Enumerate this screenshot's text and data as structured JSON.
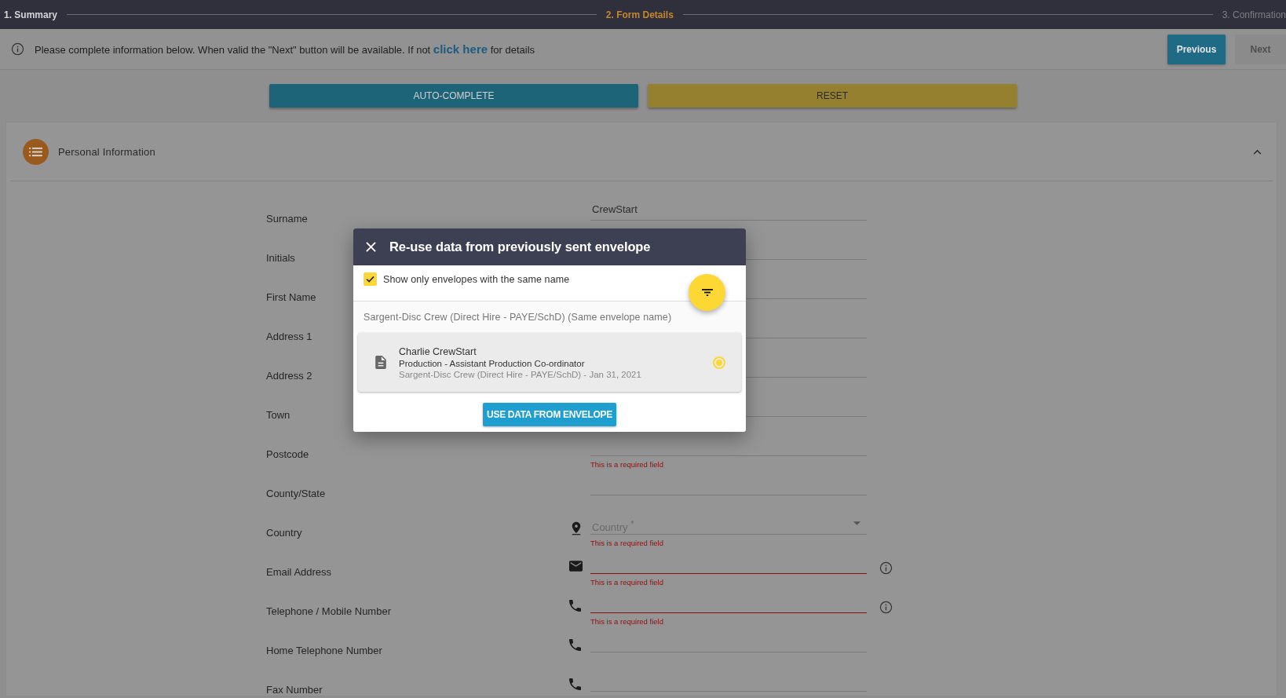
{
  "steps": [
    {
      "label": "1. Summary",
      "completed": true,
      "selected": false
    },
    {
      "label": "2. Form Details",
      "completed": false,
      "selected": true
    },
    {
      "label": "3. Confirmation",
      "completed": false,
      "selected": false
    }
  ],
  "info_bar": {
    "text_before": "Please complete information below. When valid the \"Next\" button will be available. If not ",
    "link": "click here",
    "text_after": " for details"
  },
  "nav_buttons": [
    {
      "label": "Previous",
      "disabled": false
    },
    {
      "label": "Next",
      "disabled": true
    }
  ],
  "actions": [
    {
      "label": "AUTO-COMPLETE",
      "kind": "primary"
    },
    {
      "label": "RESET",
      "kind": "warning"
    }
  ],
  "section": {
    "title": "Personal Information",
    "expanded": true
  },
  "fields": [
    {
      "label": "Surname",
      "kind": "text",
      "value": "CrewStart",
      "invalid": false
    },
    {
      "label": "Initials",
      "kind": "text",
      "invalid": false
    },
    {
      "label": "First Name",
      "kind": "text",
      "invalid": false
    },
    {
      "label": "Address 1",
      "kind": "text",
      "invalid": false
    },
    {
      "label": "Address 2",
      "kind": "text",
      "invalid": false
    },
    {
      "label": "Town",
      "kind": "text",
      "invalid": false
    },
    {
      "label": "Postcode",
      "kind": "text",
      "invalid": false,
      "error": "This is a required field"
    },
    {
      "label": "County/State",
      "kind": "text",
      "invalid": false
    },
    {
      "label": "Country",
      "kind": "select",
      "placeholder": "Country $^{*}$",
      "invalid": false,
      "error": "This is a required field"
    },
    {
      "label": "Email Address",
      "kind": "email",
      "invalid": true,
      "error": "This is a required field",
      "info": true
    },
    {
      "label": "Telephone / Mobile Number",
      "kind": "phone",
      "invalid": true,
      "error": "This is a required field",
      "info": true
    },
    {
      "label": "Home Telephone Number",
      "kind": "phone",
      "invalid": false
    },
    {
      "label": "Fax Number",
      "kind": "phone",
      "invalid": false
    }
  ],
  "dialog": {
    "title": "Re-use data from previously sent envelope",
    "filter": {
      "label": "Show only envelopes with the same name",
      "checked": true
    },
    "groups": [
      {
        "header": "Sargent-Disc Crew (Direct Hire - PAYE/SchD) (Same envelope name)",
        "envelopes": [
          {
            "name": "Charlie CrewStart",
            "role": "Production - Assistant Production Co-ordinator",
            "details": "Sargent-Disc Crew (Direct Hire - PAYE/SchD) - Jan 31, 2021",
            "selected": true
          }
        ]
      }
    ],
    "button": "USE DATA FROM ENVELOPE"
  }
}
